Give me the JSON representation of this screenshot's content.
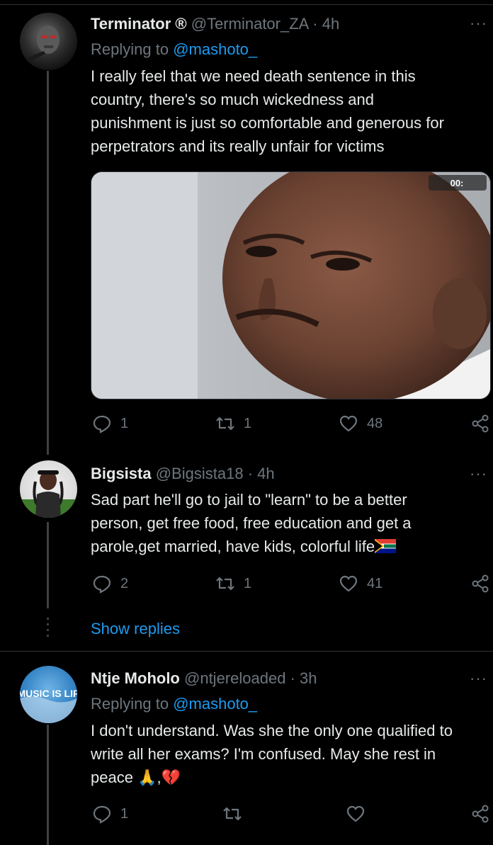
{
  "tweets": [
    {
      "name": "Terminator ®",
      "handle": "@Terminator_ZA",
      "sep": "·",
      "time": "4h",
      "replying_prefix": "Replying to",
      "replying_to": "@mashoto_",
      "lines": [
        "I really feel that we need death sentence in this",
        "country, there's so much wickedness and",
        "punishment is just so comfortable and generous for",
        "perpetrators and its really unfair for victims"
      ],
      "media_badge": "00:",
      "replies": "1",
      "retweets": "1",
      "likes": "48",
      "more": "···"
    },
    {
      "name": "Bigsista",
      "handle": "@Bigsista18",
      "sep": "·",
      "time": "4h",
      "lines": [
        "Sad part he'll go to jail to \"learn\" to be a better",
        "person, get free food, free education and get a",
        "parole,get married, have kids, colorful life"
      ],
      "replies": "2",
      "retweets": "1",
      "likes": "41",
      "more": "···"
    },
    {
      "name": "Ntje Moholo",
      "handle": "@ntjereloaded",
      "sep": "·",
      "time": "3h",
      "replying_prefix": "Replying to",
      "replying_to": "@mashoto_",
      "lines": [
        "I don't understand. Was she the only one qualified to",
        "write all her exams? I'm confused. May she rest in",
        "peace"
      ],
      "emoji_tail": "🙏,💔",
      "avatar_text": "MUSIC IS LIF",
      "replies": "1",
      "more": "···"
    }
  ],
  "show_replies": "Show replies",
  "colors": {
    "accent": "#1d9bf0",
    "muted": "#6e767d",
    "text": "#e7e9ea",
    "bg": "#000000"
  }
}
